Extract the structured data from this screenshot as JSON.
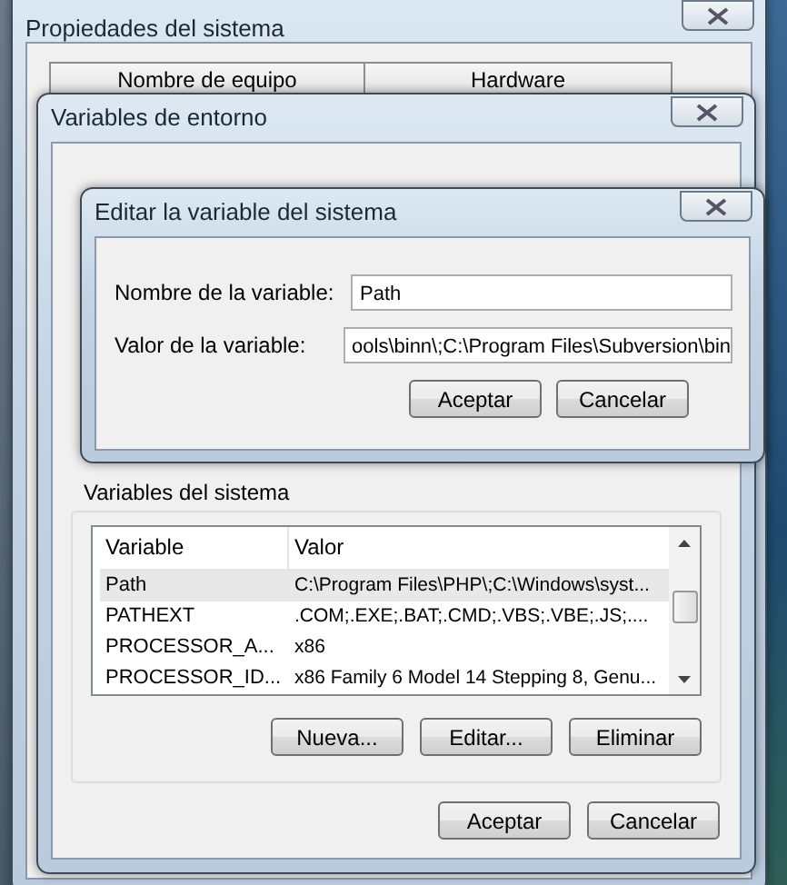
{
  "system_properties": {
    "title": "Propiedades del sistema",
    "tabs": [
      {
        "label": "Nombre de equipo",
        "selected": false
      },
      {
        "label": "Hardware",
        "selected": false
      }
    ]
  },
  "environment_variables": {
    "title": "Variables de entorno",
    "system_variables": {
      "title": "Variables del sistema",
      "columns": [
        "Variable",
        "Valor"
      ],
      "rows": [
        {
          "variable": "Path",
          "value": "C:\\Program Files\\PHP\\;C:\\Windows\\syst...",
          "selected": true
        },
        {
          "variable": "PATHEXT",
          "value": ".COM;.EXE;.BAT;.CMD;.VBS;.VBE;.JS;....",
          "selected": false
        },
        {
          "variable": "PROCESSOR_A...",
          "value": "x86",
          "selected": false
        },
        {
          "variable": "PROCESSOR_ID...",
          "value": "x86 Family 6 Model 14 Stepping 8, Genu...",
          "selected": false
        }
      ],
      "buttons": [
        "Nueva...",
        "Editar...",
        "Eliminar"
      ]
    },
    "buttons": [
      "Aceptar",
      "Cancelar"
    ]
  },
  "edit_dialog": {
    "title": "Editar la variable del sistema",
    "fields": [
      {
        "label": "Nombre de la variable:",
        "value": "Path"
      },
      {
        "label": "Valor de la variable:",
        "value": "ools\\binn\\;C:\\Program Files\\Subversion\\bin"
      }
    ],
    "buttons": [
      "Aceptar",
      "Cancelar"
    ]
  }
}
